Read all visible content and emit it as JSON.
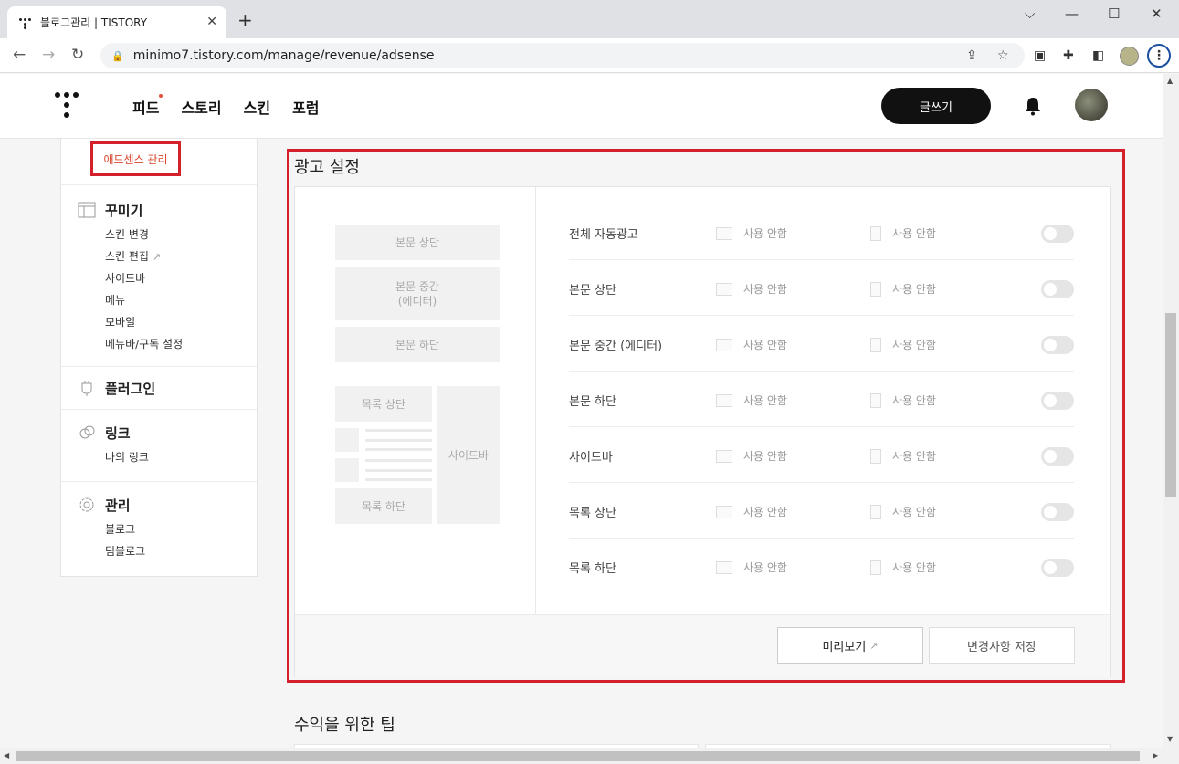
{
  "browser": {
    "tab_title": "블로그관리 | TISTORY",
    "tab_close": "✕",
    "new_tab": "+",
    "url": "minimo7.tistory.com/manage/revenue/adsense",
    "window_controls": [
      "⌵",
      "—",
      "☐",
      "✕"
    ],
    "back": "←",
    "forward": "→",
    "reload": "↻"
  },
  "header": {
    "nav": [
      "피드",
      "스토리",
      "스킨",
      "포럼"
    ],
    "write_label": "글쓰기"
  },
  "sidebar": {
    "adsense_label": "애드센스 관리",
    "groups": [
      {
        "title": "꾸미기",
        "icon": "layout-icon",
        "items": [
          "스킨 변경",
          "스킨 편집",
          "사이드바",
          "메뉴",
          "모바일",
          "메뉴바/구독 설정"
        ]
      },
      {
        "title": "플러그인",
        "icon": "plug-icon",
        "items": []
      },
      {
        "title": "링크",
        "icon": "link-icon",
        "items": [
          "나의 링크"
        ]
      },
      {
        "title": "관리",
        "icon": "gear-icon",
        "items": [
          "블로그",
          "팀블로그"
        ]
      }
    ]
  },
  "ad_settings": {
    "title": "광고 설정",
    "preview": {
      "top": "본문 상단",
      "middle": "본문 중간",
      "middle_sub": "(에디터)",
      "bottom": "본문 하단",
      "list_top": "목록 상단",
      "list_bottom": "목록 하단",
      "sidebar": "사이드바"
    },
    "rows": [
      {
        "label": "전체 자동광고",
        "pc": "사용 안함",
        "mobile": "사용 안함",
        "enabled": false
      },
      {
        "label": "본문 상단",
        "pc": "사용 안함",
        "mobile": "사용 안함",
        "enabled": false
      },
      {
        "label": "본문 중간 (에디터)",
        "pc": "사용 안함",
        "mobile": "사용 안함",
        "enabled": false
      },
      {
        "label": "본문 하단",
        "pc": "사용 안함",
        "mobile": "사용 안함",
        "enabled": false
      },
      {
        "label": "사이드바",
        "pc": "사용 안함",
        "mobile": "사용 안함",
        "enabled": false
      },
      {
        "label": "목록 상단",
        "pc": "사용 안함",
        "mobile": "사용 안함",
        "enabled": false
      },
      {
        "label": "목록 하단",
        "pc": "사용 안함",
        "mobile": "사용 안함",
        "enabled": false
      }
    ],
    "preview_button": "미리보기",
    "save_button": "변경사항 저장"
  },
  "tips": {
    "title": "수익을 위한 팁"
  },
  "colors": {
    "highlight": "#d3202a",
    "accent_text": "#d9452b"
  }
}
